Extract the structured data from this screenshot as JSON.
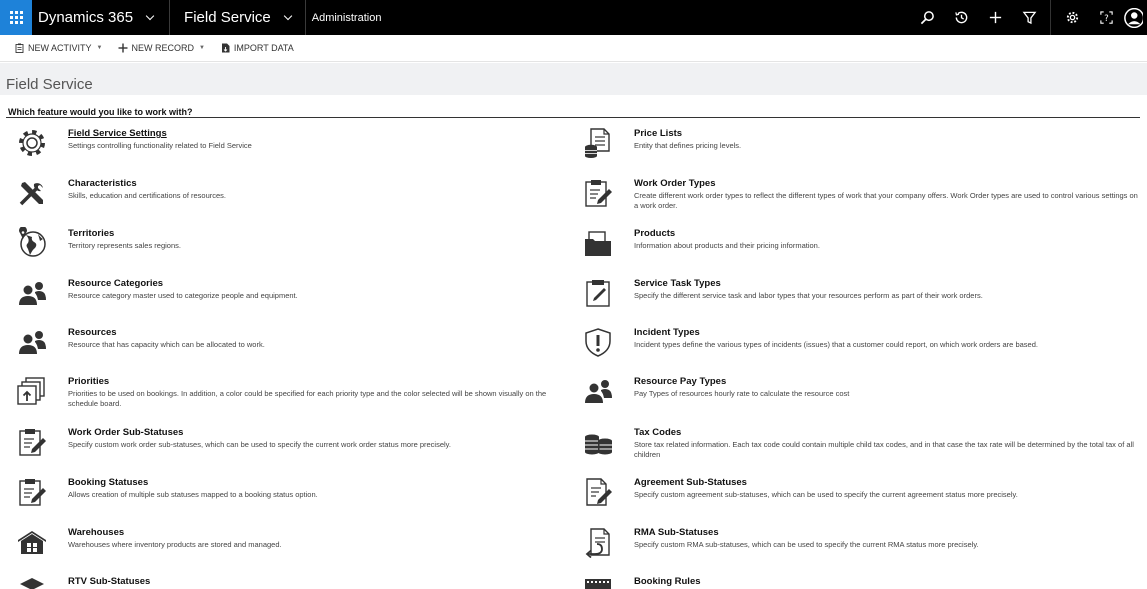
{
  "nav": {
    "app": "Dynamics 365",
    "area": "Field Service",
    "breadcrumb": "Administration"
  },
  "commands": {
    "new_activity": "NEW ACTIVITY",
    "new_record": "NEW RECORD",
    "import_data": "IMPORT DATA"
  },
  "page": {
    "title": "Field Service",
    "question": "Which feature would you like to work with?"
  },
  "features_left": [
    {
      "title": "Field Service Settings",
      "desc": "Settings controlling functionality related to Field Service",
      "icon": "gear-icon"
    },
    {
      "title": "Characteristics",
      "desc": "Skills, education and certifications of resources.",
      "icon": "tools-icon"
    },
    {
      "title": "Territories",
      "desc": "Territory represents sales regions.",
      "icon": "globe-icon"
    },
    {
      "title": "Resource Categories",
      "desc": "Resource category master used to categorize people and equipment.",
      "icon": "people-icon"
    },
    {
      "title": "Resources",
      "desc": "Resource that has capacity which can be allocated to work.",
      "icon": "people-icon"
    },
    {
      "title": "Priorities",
      "desc": "Priorities to be used on bookings. In addition, a color could be specified for each priority type and the color selected will be shown visually on the schedule board.",
      "icon": "stack-icon"
    },
    {
      "title": "Work Order Sub-Statuses",
      "desc": "Specify custom work order sub-statuses, which can be used to specify the current work order status more precisely.",
      "icon": "clipboard-edit-icon"
    },
    {
      "title": "Booking Statuses",
      "desc": "Allows creation of multiple sub statuses mapped to a booking status option.",
      "icon": "clipboard-edit-icon"
    },
    {
      "title": "Warehouses",
      "desc": "Warehouses where inventory products are stored and managed.",
      "icon": "warehouse-icon"
    },
    {
      "title": "RTV Sub-Statuses",
      "desc": "",
      "icon": "box-icon"
    }
  ],
  "features_right": [
    {
      "title": "Price Lists",
      "desc": "Entity that defines pricing levels.",
      "icon": "pricelist-icon"
    },
    {
      "title": "Work Order Types",
      "desc": "Create different work order types to reflect the different types of work that your company offers. Work Order types are used to control various settings on a work order.",
      "icon": "clipboard-edit-icon"
    },
    {
      "title": "Products",
      "desc": "Information about products and their pricing information.",
      "icon": "folder-icon"
    },
    {
      "title": "Service Task Types",
      "desc": "Specify the different service task and labor types that your resources perform as part of their work orders.",
      "icon": "clipboard-edit-icon"
    },
    {
      "title": "Incident Types",
      "desc": "Incident types define the various types of incidents (issues) that a customer could report, on which work orders are based.",
      "icon": "shield-alert-icon"
    },
    {
      "title": "Resource Pay Types",
      "desc": "Pay Types of resources hourly rate to calculate the resource cost",
      "icon": "people-icon"
    },
    {
      "title": "Tax Codes",
      "desc": "Store tax related information. Each tax code could contain multiple child tax codes, and in that case the tax rate will be determined by the total tax of all children",
      "icon": "coins-icon"
    },
    {
      "title": "Agreement Sub-Statuses",
      "desc": "Specify custom agreement sub-statuses, which can be used to specify the current agreement status more precisely.",
      "icon": "document-edit-icon"
    },
    {
      "title": "RMA Sub-Statuses",
      "desc": "Specify custom RMA sub-statuses, which can be used to specify the current RMA status more precisely.",
      "icon": "document-return-icon"
    },
    {
      "title": "Booking Rules",
      "desc": "",
      "icon": "keyboard-icon"
    }
  ]
}
